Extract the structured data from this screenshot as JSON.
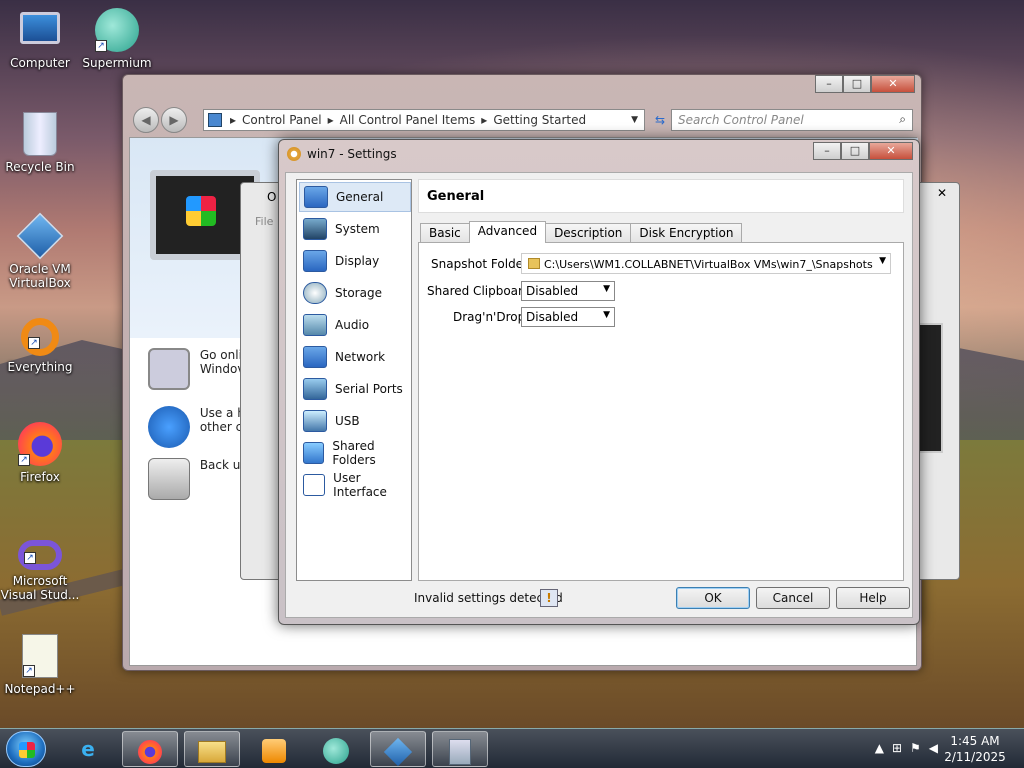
{
  "desktop_icons": [
    {
      "label": "Computer"
    },
    {
      "label": "Supermium"
    },
    {
      "label": "Recycle Bin"
    },
    {
      "label": "Oracle VM VirtualBox"
    },
    {
      "label": "Everything"
    },
    {
      "label": "Firefox"
    },
    {
      "label": "Microsoft Visual Stud..."
    },
    {
      "label": "Notepad++"
    }
  ],
  "control_panel": {
    "breadcrumb": [
      "Control Panel",
      "All Control Panel Items",
      "Getting Started"
    ],
    "search_placeholder": "Search Control Panel",
    "tasks": [
      "Go onli",
      "Windov",
      "Use a h",
      "other c",
      "Back up"
    ]
  },
  "vm_manager": {
    "title_fragment": "O",
    "menu_fragment": "File"
  },
  "settings_dialog": {
    "title": "win7  - Settings",
    "sidebar": [
      {
        "label": "General",
        "selected": true
      },
      {
        "label": "System"
      },
      {
        "label": "Display"
      },
      {
        "label": "Storage"
      },
      {
        "label": "Audio"
      },
      {
        "label": "Network"
      },
      {
        "label": "Serial Ports"
      },
      {
        "label": "USB"
      },
      {
        "label": "Shared Folders"
      },
      {
        "label": "User Interface"
      }
    ],
    "section_title": "General",
    "tabs": [
      {
        "label": "Basic"
      },
      {
        "label": "Advanced",
        "selected": true
      },
      {
        "label": "Description"
      },
      {
        "label": "Disk Encryption"
      }
    ],
    "snapshot_folder_label": "Snapshot Folder:",
    "snapshot_folder_value": "C:\\Users\\WM1.COLLABNET\\VirtualBox VMs\\win7_\\Snapshots",
    "shared_clipboard_label": "Shared Clipboard:",
    "shared_clipboard_value": "Disabled",
    "dragndrop_label": "Drag'n'Drop:",
    "dragndrop_value": "Disabled",
    "status_message": "Invalid settings detected",
    "ok": "OK",
    "cancel": "Cancel",
    "help": "Help"
  },
  "taskbar": {
    "time": "1:45 AM",
    "date": "2/11/2025"
  }
}
